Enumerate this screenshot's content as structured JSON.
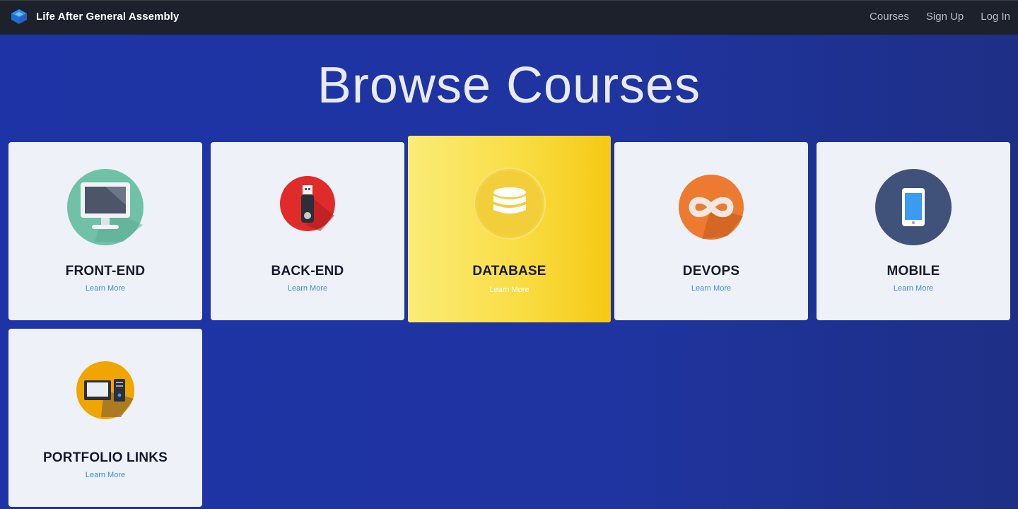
{
  "nav": {
    "brand": "Life After General Assembly",
    "links": [
      "Courses",
      "Sign Up",
      "Log In"
    ]
  },
  "hero": {
    "title": "Browse Courses"
  },
  "courses": [
    {
      "title": "FRONT-END",
      "link": "Learn More",
      "icon": "monitor-icon"
    },
    {
      "title": "BACK-END",
      "link": "Learn More",
      "icon": "usb-drive-icon"
    },
    {
      "title": "DATABASE",
      "link": "Learn More",
      "icon": "database-icon"
    },
    {
      "title": "DEVOPS",
      "link": "Learn More",
      "icon": "infinity-icon"
    },
    {
      "title": "MOBILE",
      "link": "Learn More",
      "icon": "smartphone-icon"
    },
    {
      "title": "PORTFOLIO LINKS",
      "link": "Learn More",
      "icon": "desktop-computer-icon"
    }
  ],
  "colors": {
    "navbar": "#1c212b",
    "background": "#1f34a0",
    "card": "#eef1f7",
    "active_card": "#f9dd44",
    "link": "#3d8fd6"
  }
}
